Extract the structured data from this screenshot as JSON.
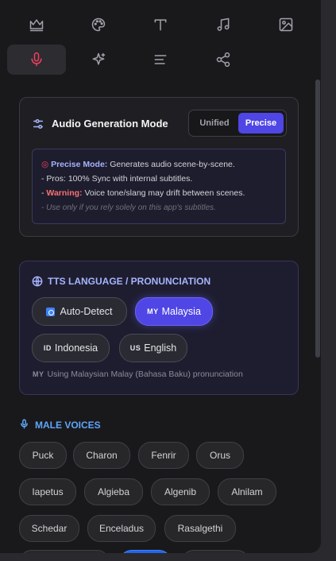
{
  "toolbar": {
    "tools": [
      {
        "name": "crown-icon",
        "active": false
      },
      {
        "name": "palette-icon",
        "active": false
      },
      {
        "name": "text-icon",
        "active": false
      },
      {
        "name": "music-icon",
        "active": false
      },
      {
        "name": "image-icon",
        "active": false
      },
      {
        "name": "microphone-icon",
        "active": true
      },
      {
        "name": "sparkles-icon",
        "active": false
      },
      {
        "name": "align-left-icon",
        "active": false
      },
      {
        "name": "share-icon",
        "active": false
      }
    ]
  },
  "audio_mode": {
    "title": "Audio Generation Mode",
    "options": [
      "Unified",
      "Precise"
    ],
    "selected": "Precise",
    "info": {
      "line1_label": "Precise Mode:",
      "line1_text": " Generates audio scene-by-scene.",
      "line2": "- Pros: 100% Sync with internal subtitles.",
      "line3_prefix": "- ",
      "line3_label": "Warning:",
      "line3_text": " Voice tone/slang may drift between scenes.",
      "line4": "- Use only if you rely solely on this app's subtitles."
    }
  },
  "language": {
    "title": "TTS LANGUAGE / PRONUNCIATION",
    "options": [
      {
        "code": "",
        "label": "Auto-Detect"
      },
      {
        "code": "MY",
        "label": "Malaysia"
      },
      {
        "code": "ID",
        "label": "Indonesia"
      },
      {
        "code": "US",
        "label": "English"
      }
    ],
    "selected": "Malaysia",
    "note_code": "MY",
    "note": "Using Malaysian Malay (Bahasa Baku) pronunciation"
  },
  "male_voices": {
    "title": "MALE VOICES",
    "voices": [
      "Puck",
      "Charon",
      "Fenrir",
      "Orus",
      "Iapetus",
      "Algieba",
      "Algenib",
      "Alnilam",
      "Schedar",
      "Enceladus",
      "Rasalgethi"
    ]
  },
  "colors": {
    "accent": "#4f46e5",
    "active_tool": "#f43f5e",
    "male_heading": "#60a5fa",
    "warning": "#f87171"
  }
}
